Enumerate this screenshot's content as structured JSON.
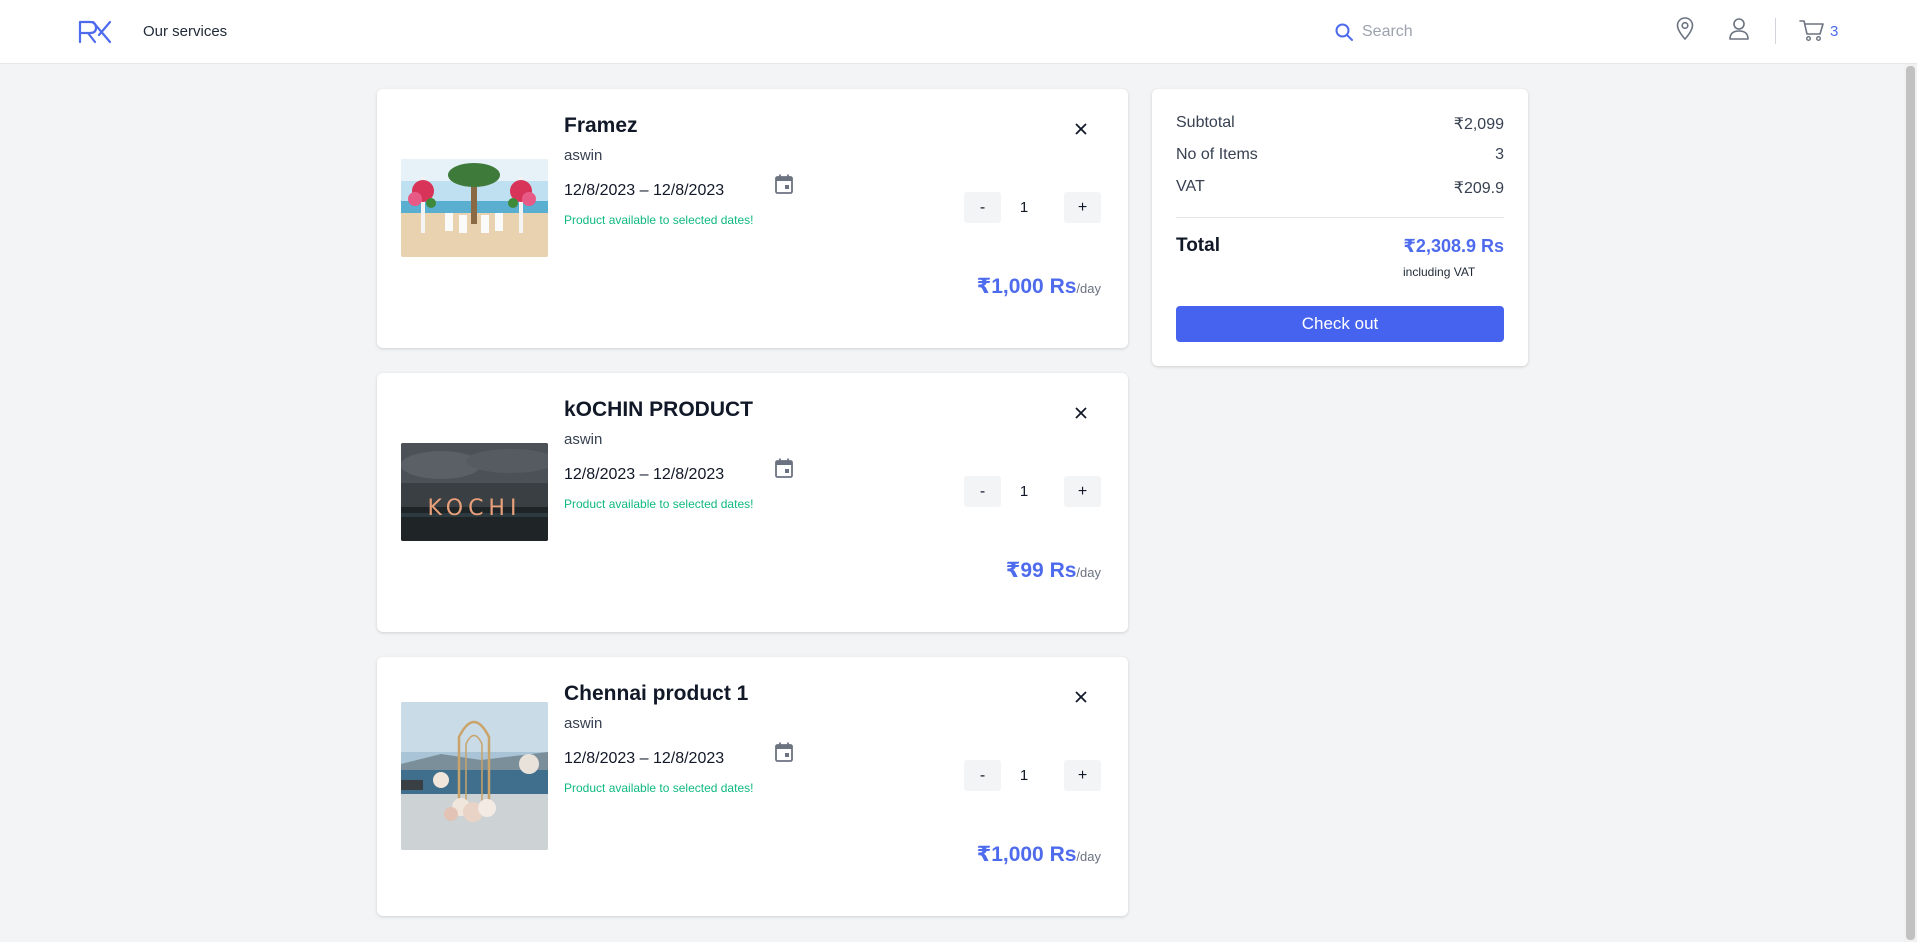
{
  "header": {
    "logo_alt": "RX",
    "nav_link": "Our services",
    "search_placeholder": "Search",
    "cart_count": "3"
  },
  "cart": {
    "items": [
      {
        "name": "Framez",
        "seller": "aswin",
        "dates": "12/8/2023 – 12/8/2023",
        "availability": "Product available to selected dates!",
        "quantity": "1",
        "minus_label": "-",
        "plus_label": "+",
        "price": "₹1,000 Rs",
        "price_unit": "/day",
        "image": "beach-wedding-arch"
      },
      {
        "name": "kOCHIN PRODUCT",
        "seller": "aswin",
        "dates": "12/8/2023 – 12/8/2023",
        "availability": "Product available to selected dates!",
        "quantity": "1",
        "minus_label": "-",
        "plus_label": "+",
        "price": "₹99 Rs",
        "price_unit": "/day",
        "image": "kochi-sign"
      },
      {
        "name": "Chennai product 1",
        "seller": "aswin",
        "dates": "12/8/2023 – 12/8/2023",
        "availability": "Product available to selected dates!",
        "quantity": "1",
        "minus_label": "-",
        "plus_label": "+",
        "price": "₹1,000 Rs",
        "price_unit": "/day",
        "image": "golden-arch-flowers"
      }
    ]
  },
  "summary": {
    "subtotal_label": "Subtotal",
    "subtotal_value": "₹2,099",
    "items_label": "No of Items",
    "items_value": "3",
    "vat_label": "VAT",
    "vat_value": "₹209.9",
    "total_label": "Total",
    "total_value": "₹2,308.9 Rs",
    "vat_note": "including VAT",
    "checkout_label": "Check out"
  },
  "colors": {
    "accent": "#4f6bed",
    "button": "#4563ef",
    "available": "#10b981",
    "background": "#f3f4f6"
  }
}
